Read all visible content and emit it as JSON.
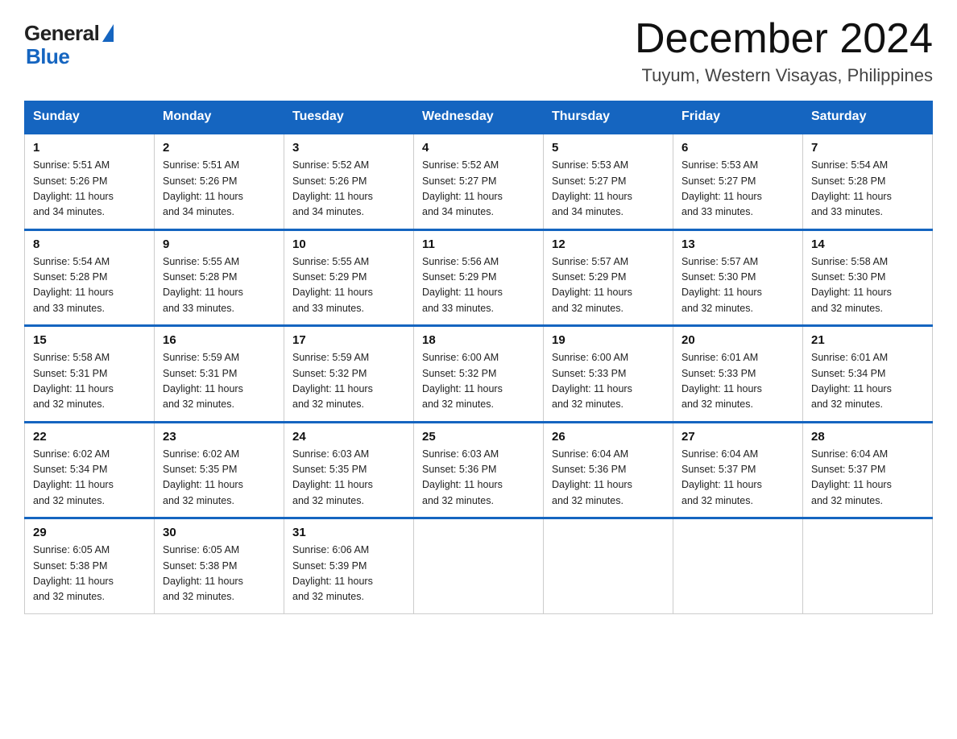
{
  "header": {
    "logo_general": "General",
    "logo_blue": "Blue",
    "month_title": "December 2024",
    "location": "Tuyum, Western Visayas, Philippines"
  },
  "days_of_week": [
    "Sunday",
    "Monday",
    "Tuesday",
    "Wednesday",
    "Thursday",
    "Friday",
    "Saturday"
  ],
  "weeks": [
    [
      {
        "day": "1",
        "sunrise": "5:51 AM",
        "sunset": "5:26 PM",
        "daylight": "11 hours and 34 minutes."
      },
      {
        "day": "2",
        "sunrise": "5:51 AM",
        "sunset": "5:26 PM",
        "daylight": "11 hours and 34 minutes."
      },
      {
        "day": "3",
        "sunrise": "5:52 AM",
        "sunset": "5:26 PM",
        "daylight": "11 hours and 34 minutes."
      },
      {
        "day": "4",
        "sunrise": "5:52 AM",
        "sunset": "5:27 PM",
        "daylight": "11 hours and 34 minutes."
      },
      {
        "day": "5",
        "sunrise": "5:53 AM",
        "sunset": "5:27 PM",
        "daylight": "11 hours and 34 minutes."
      },
      {
        "day": "6",
        "sunrise": "5:53 AM",
        "sunset": "5:27 PM",
        "daylight": "11 hours and 33 minutes."
      },
      {
        "day": "7",
        "sunrise": "5:54 AM",
        "sunset": "5:28 PM",
        "daylight": "11 hours and 33 minutes."
      }
    ],
    [
      {
        "day": "8",
        "sunrise": "5:54 AM",
        "sunset": "5:28 PM",
        "daylight": "11 hours and 33 minutes."
      },
      {
        "day": "9",
        "sunrise": "5:55 AM",
        "sunset": "5:28 PM",
        "daylight": "11 hours and 33 minutes."
      },
      {
        "day": "10",
        "sunrise": "5:55 AM",
        "sunset": "5:29 PM",
        "daylight": "11 hours and 33 minutes."
      },
      {
        "day": "11",
        "sunrise": "5:56 AM",
        "sunset": "5:29 PM",
        "daylight": "11 hours and 33 minutes."
      },
      {
        "day": "12",
        "sunrise": "5:57 AM",
        "sunset": "5:29 PM",
        "daylight": "11 hours and 32 minutes."
      },
      {
        "day": "13",
        "sunrise": "5:57 AM",
        "sunset": "5:30 PM",
        "daylight": "11 hours and 32 minutes."
      },
      {
        "day": "14",
        "sunrise": "5:58 AM",
        "sunset": "5:30 PM",
        "daylight": "11 hours and 32 minutes."
      }
    ],
    [
      {
        "day": "15",
        "sunrise": "5:58 AM",
        "sunset": "5:31 PM",
        "daylight": "11 hours and 32 minutes."
      },
      {
        "day": "16",
        "sunrise": "5:59 AM",
        "sunset": "5:31 PM",
        "daylight": "11 hours and 32 minutes."
      },
      {
        "day": "17",
        "sunrise": "5:59 AM",
        "sunset": "5:32 PM",
        "daylight": "11 hours and 32 minutes."
      },
      {
        "day": "18",
        "sunrise": "6:00 AM",
        "sunset": "5:32 PM",
        "daylight": "11 hours and 32 minutes."
      },
      {
        "day": "19",
        "sunrise": "6:00 AM",
        "sunset": "5:33 PM",
        "daylight": "11 hours and 32 minutes."
      },
      {
        "day": "20",
        "sunrise": "6:01 AM",
        "sunset": "5:33 PM",
        "daylight": "11 hours and 32 minutes."
      },
      {
        "day": "21",
        "sunrise": "6:01 AM",
        "sunset": "5:34 PM",
        "daylight": "11 hours and 32 minutes."
      }
    ],
    [
      {
        "day": "22",
        "sunrise": "6:02 AM",
        "sunset": "5:34 PM",
        "daylight": "11 hours and 32 minutes."
      },
      {
        "day": "23",
        "sunrise": "6:02 AM",
        "sunset": "5:35 PM",
        "daylight": "11 hours and 32 minutes."
      },
      {
        "day": "24",
        "sunrise": "6:03 AM",
        "sunset": "5:35 PM",
        "daylight": "11 hours and 32 minutes."
      },
      {
        "day": "25",
        "sunrise": "6:03 AM",
        "sunset": "5:36 PM",
        "daylight": "11 hours and 32 minutes."
      },
      {
        "day": "26",
        "sunrise": "6:04 AM",
        "sunset": "5:36 PM",
        "daylight": "11 hours and 32 minutes."
      },
      {
        "day": "27",
        "sunrise": "6:04 AM",
        "sunset": "5:37 PM",
        "daylight": "11 hours and 32 minutes."
      },
      {
        "day": "28",
        "sunrise": "6:04 AM",
        "sunset": "5:37 PM",
        "daylight": "11 hours and 32 minutes."
      }
    ],
    [
      {
        "day": "29",
        "sunrise": "6:05 AM",
        "sunset": "5:38 PM",
        "daylight": "11 hours and 32 minutes."
      },
      {
        "day": "30",
        "sunrise": "6:05 AM",
        "sunset": "5:38 PM",
        "daylight": "11 hours and 32 minutes."
      },
      {
        "day": "31",
        "sunrise": "6:06 AM",
        "sunset": "5:39 PM",
        "daylight": "11 hours and 32 minutes."
      },
      null,
      null,
      null,
      null
    ]
  ],
  "labels": {
    "sunrise": "Sunrise:",
    "sunset": "Sunset:",
    "daylight": "Daylight:"
  }
}
